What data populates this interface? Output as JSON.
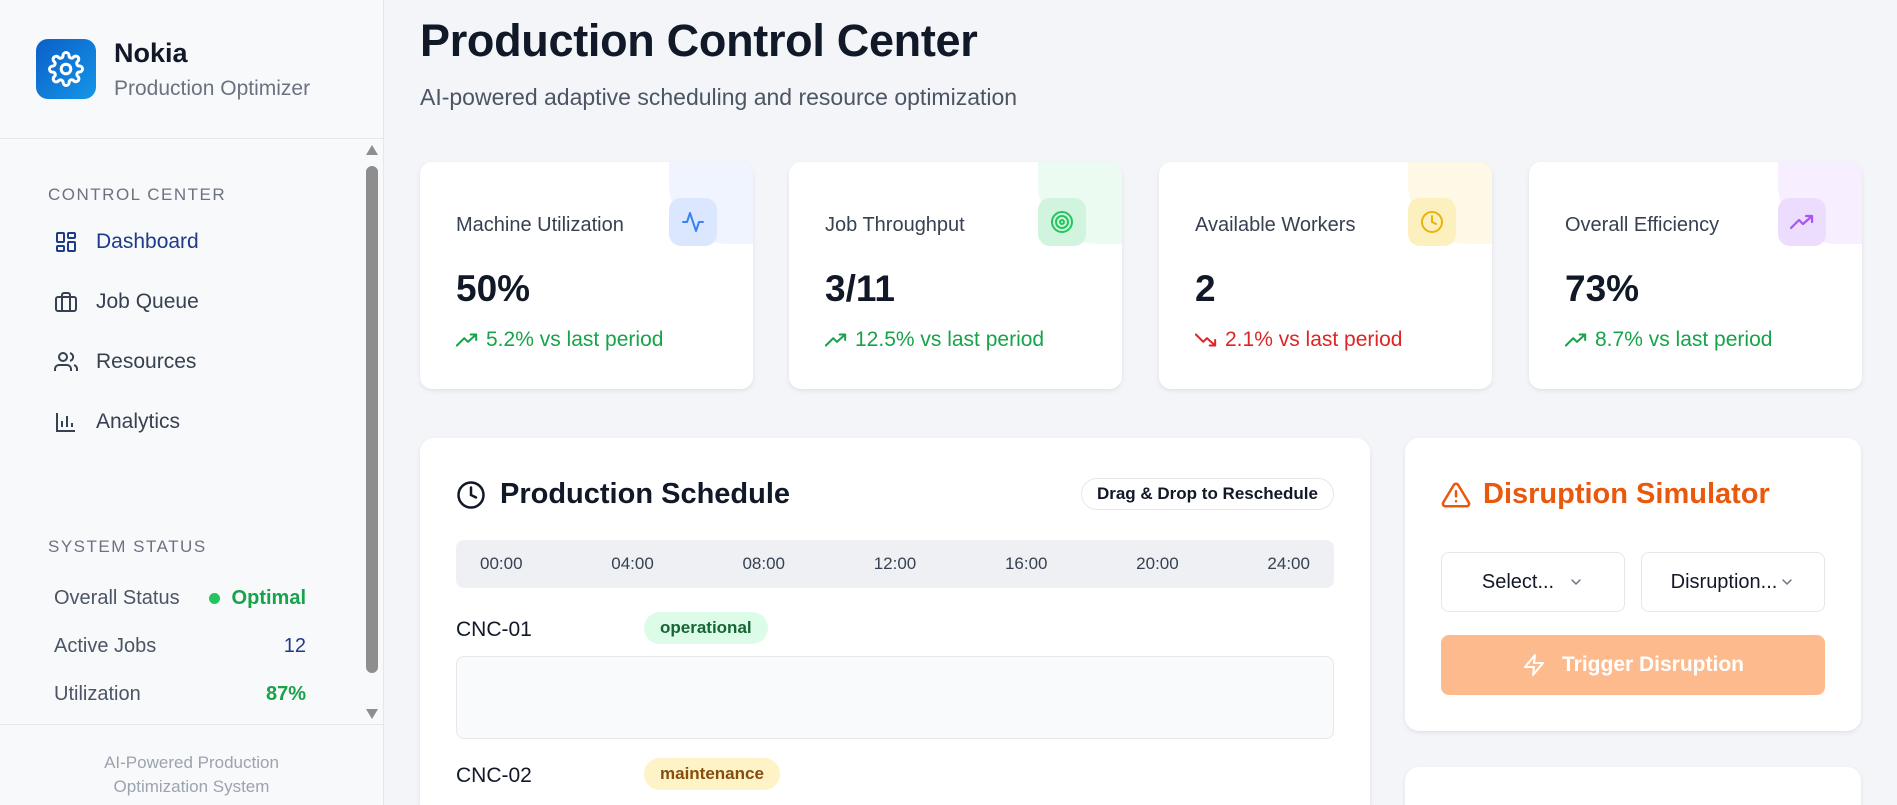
{
  "brand": {
    "name": "Nokia",
    "subtitle": "Production Optimizer"
  },
  "sidebar": {
    "control_label": "CONTROL CENTER",
    "nav": [
      {
        "label": "Dashboard",
        "icon": "dashboard-icon",
        "active": true
      },
      {
        "label": "Job Queue",
        "icon": "briefcase-icon",
        "active": false
      },
      {
        "label": "Resources",
        "icon": "users-icon",
        "active": false
      },
      {
        "label": "Analytics",
        "icon": "bar-chart-icon",
        "active": false
      }
    ],
    "status_label": "SYSTEM STATUS",
    "status": [
      {
        "label": "Overall Status",
        "value": "Optimal"
      },
      {
        "label": "Active Jobs",
        "value": "12"
      },
      {
        "label": "Utilization",
        "value": "87%"
      }
    ],
    "footer": [
      "AI-Powered Production",
      "Optimization System"
    ]
  },
  "header": {
    "title": "Production Control Center",
    "subtitle": "AI-powered adaptive scheduling and resource optimization"
  },
  "stats": [
    {
      "label": "Machine Utilization",
      "value": "50%",
      "trend": "5.2% vs last period",
      "direction": "up",
      "icon": "activity-icon",
      "color": "#3b82f6"
    },
    {
      "label": "Job Throughput",
      "value": "3/11",
      "trend": "12.5% vs last period",
      "direction": "up",
      "icon": "target-icon",
      "color": "#22c55e"
    },
    {
      "label": "Available Workers",
      "value": "2",
      "trend": "2.1% vs last period",
      "direction": "down",
      "icon": "clock-icon",
      "color": "#eab308"
    },
    {
      "label": "Overall Efficiency",
      "value": "73%",
      "trend": "8.7% vs last period",
      "direction": "up",
      "icon": "trending-up-icon",
      "color": "#a855f7"
    }
  ],
  "schedule": {
    "title": "Production Schedule",
    "drag_hint": "Drag & Drop to Reschedule",
    "times": [
      "00:00",
      "04:00",
      "08:00",
      "12:00",
      "16:00",
      "20:00",
      "24:00"
    ],
    "machines": [
      {
        "name": "CNC-01",
        "status": "operational"
      },
      {
        "name": "CNC-02",
        "status": "maintenance"
      }
    ]
  },
  "disruption": {
    "title": "Disruption Simulator",
    "select_machine_placeholder": "Select...",
    "select_type_placeholder": "Disruption...",
    "trigger_label": "Trigger Disruption"
  },
  "colors": {
    "accent": "#1e3a8a",
    "success": "#16a34a",
    "danger": "#dc2626",
    "warning": "#ea580c"
  }
}
